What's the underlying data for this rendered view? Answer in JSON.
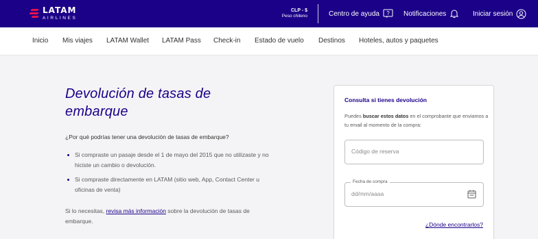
{
  "colors": {
    "brand": "#1b0088",
    "accent": "#e8114b"
  },
  "header": {
    "logo_main": "LATAM",
    "logo_sub": "AIRLINES",
    "currency_code": "CLP - $",
    "currency_name": "Peso chileno",
    "help_label": "Centro de ayuda",
    "notifications_label": "Notificaciones",
    "login_label": "Iniciar sesión",
    "icons": {
      "help": "help-box-icon",
      "notifications": "bell-icon",
      "login": "user-circle-icon"
    }
  },
  "nav": {
    "items": [
      "Inicio",
      "Mis viajes",
      "LATAM Wallet",
      "LATAM Pass",
      "Check-in",
      "Estado de vuelo",
      "Destinos",
      "Hoteles, autos y paquetes"
    ]
  },
  "main": {
    "title": "Devolución de tasas de embarque",
    "question": "¿Por qué podrías tener una devolución de tasas de embarque?",
    "bullets": [
      "Si compraste un pasaje desde el 1 de mayo del 2015 que no utilizaste y no hiciste un cambio o devolución.",
      "Si compraste directamente en LATAM (sitio web, App, Contact Center u oficinas de venta)"
    ],
    "para_before": "Si lo necesitas, ",
    "para_link": "revisa más información",
    "para_after": " sobre la devolución de tasas de embarque."
  },
  "card": {
    "title": "Consulta si tienes devolución",
    "desc_before": "Puedes ",
    "desc_bold": "buscar estos datos",
    "desc_after": " en el comprobante que enviamos a tu email al momento de la compra:",
    "reservation_placeholder": "Código de reserva",
    "date_label": "Fecha de compra",
    "date_placeholder": "dd/mm/aaaa",
    "where_link": "¿Dónde encontrarlos?",
    "icons": {
      "date": "calendar-icon"
    }
  }
}
